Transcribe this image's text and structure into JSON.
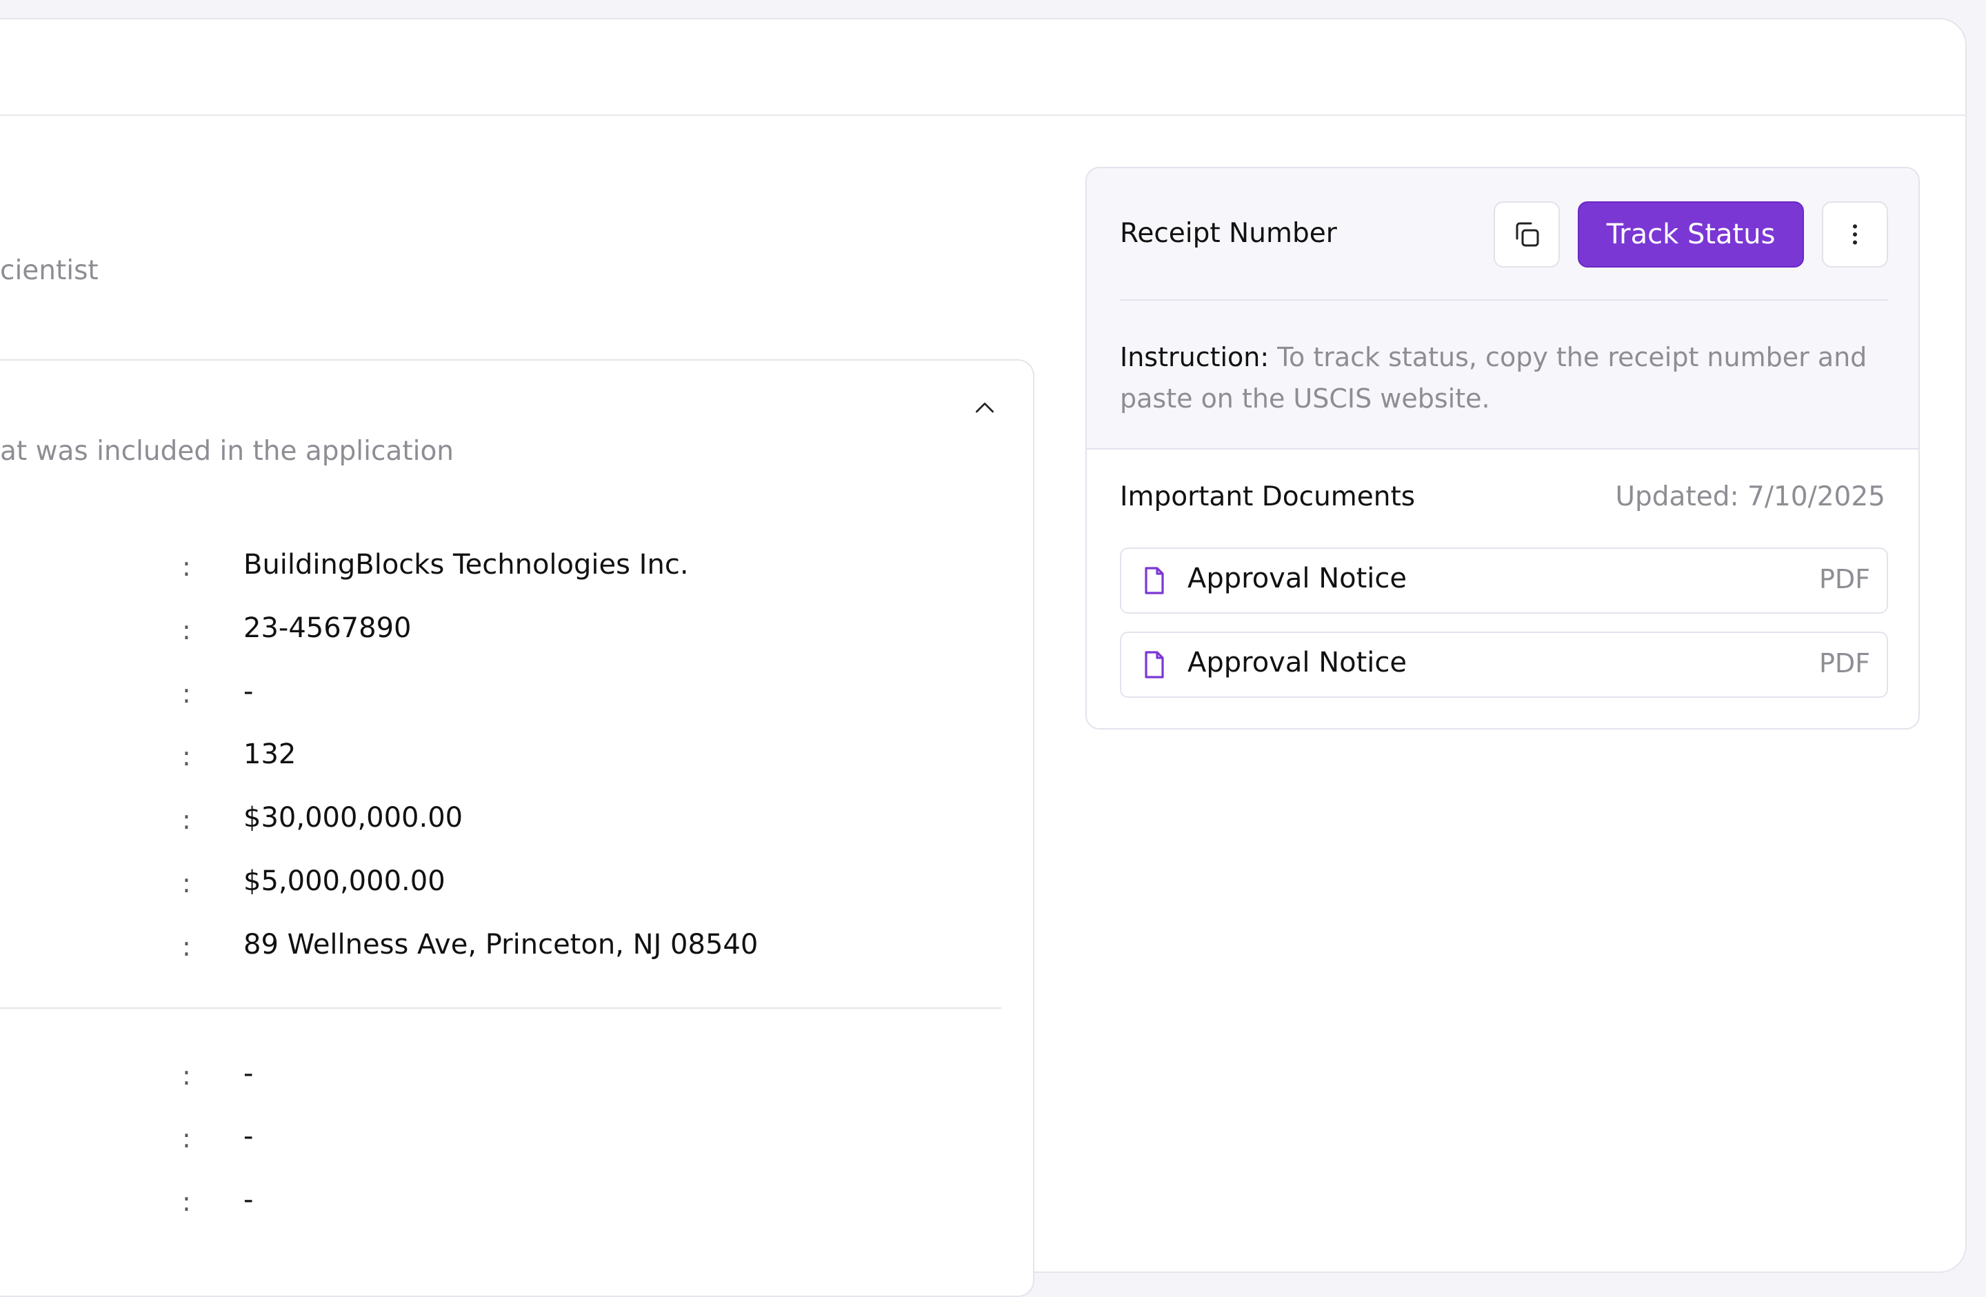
{
  "page": {
    "subtitle_fragment": "cientist"
  },
  "details_card": {
    "description_fragment": "at was included in the application",
    "rows": [
      {
        "value": "BuildingBlocks Technologies Inc."
      },
      {
        "value": "23-4567890"
      },
      {
        "value": "-"
      },
      {
        "value": "132"
      },
      {
        "value": "$30,000,000.00"
      },
      {
        "value": "$5,000,000.00"
      },
      {
        "value": "89 Wellness Ave, Princeton, NJ 08540"
      }
    ],
    "rows_second": [
      {
        "value": "-"
      },
      {
        "value": "-"
      },
      {
        "value": "-"
      }
    ],
    "separator": ":"
  },
  "receipt": {
    "title": "Receipt Number",
    "track_label": "Track Status",
    "instruction_label": "Instruction:",
    "instruction_text": " To track status, copy the receipt number and paste on the USCIS website."
  },
  "documents": {
    "title": "Important Documents",
    "updated": "Updated: 7/10/2025",
    "items": [
      {
        "name": "Approval Notice",
        "type": "PDF"
      },
      {
        "name": "Approval Notice",
        "type": "PDF"
      }
    ]
  },
  "colors": {
    "accent": "#7b37d4",
    "muted_text": "#8d8d94",
    "border": "#e4e2ec"
  },
  "icons": {
    "collapse": "chevron-up-icon",
    "copy": "copy-icon",
    "more": "more-vertical-icon",
    "document": "file-icon"
  }
}
